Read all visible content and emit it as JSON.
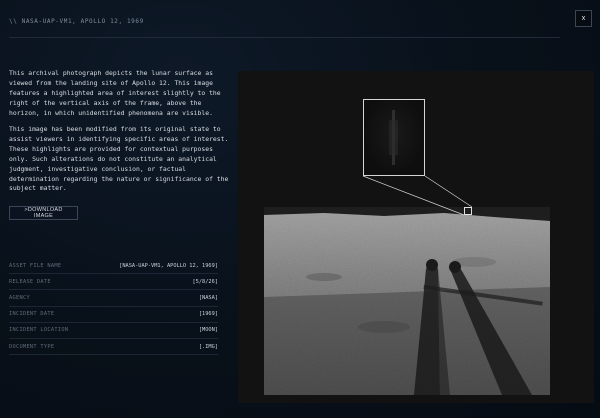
{
  "header": {
    "title": "\\\\  NASA-UAP-VM1, APOLLO 12, 1969",
    "close_label": "x"
  },
  "description": {
    "paragraph_1": "This archival photograph depicts the lunar surface as viewed from the landing site of Apollo 12. This image features a highlighted area of interest slightly to the right of the vertical axis of the frame, above the horizon, in which unidentified phenomena are visible.",
    "paragraph_2": "This image has been modified from its original state to assist viewers in identifying specific areas of interest. These highlights are provided for contextual purposes only. Such alterations do not constitute an analytical judgment, investigative conclusion, or factual determination regarding the nature or significance of the subject matter."
  },
  "download": {
    "label": ">DOWNLOAD IMAGE"
  },
  "metadata": [
    {
      "label": "ASSET FILE NAME",
      "value": "[NASA-UAP-VM1, APOLLO 12, 1969]"
    },
    {
      "label": "RELEASE DATE",
      "value": "[5/8/26]"
    },
    {
      "label": "AGENCY",
      "value": "[NASA]"
    },
    {
      "label": "INCIDENT DATE",
      "value": "[1969]"
    },
    {
      "label": "INCIDENT LOCATION",
      "value": "[MOON]"
    },
    {
      "label": "DOCUMENT TYPE",
      "value": "[.IMG]"
    }
  ],
  "colors": {
    "background": "#081019",
    "highlight_border": "#d5d5d5",
    "panel": "#121212"
  }
}
